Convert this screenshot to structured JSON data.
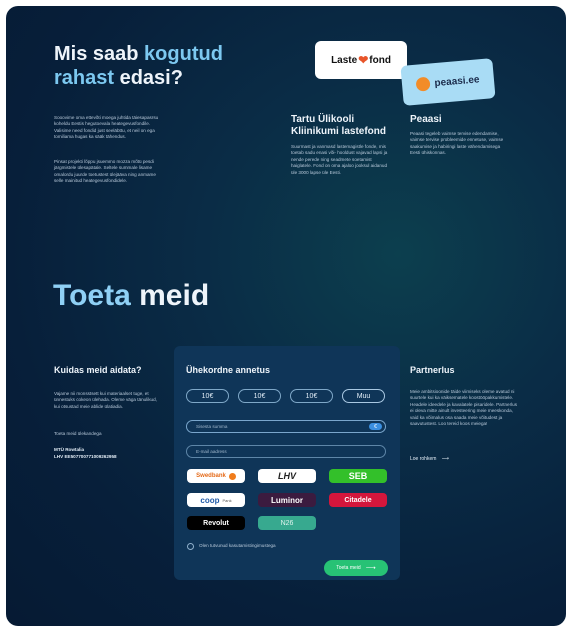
{
  "top": {
    "title_part1": "Mis saab ",
    "title_accent1": "kogutud",
    "title_accent2": "rahast",
    "title_part2": " edasi?",
    "intro_p1": "Sooovime oma ettevõti moega juhtida täiesapasrsu koheldu Eestis hegutoevala heategevusfondile. Valisime need fondid just seeläbttu, et neil on ega tomiliama hugas ka sääk tähendus.",
    "intro_p2": "Pinsat projekti lõppu jsuemmo mozza mõtü pesdi järgmistele ülesapätale. Seltele summale lisame omalordu juurde toetustest ülejääva ning anmame selle mainitud heategevusfondidele."
  },
  "fund1": {
    "logo_text": "Laste",
    "logo_text2": "fond",
    "title_line1": "Tartu Ülikooli",
    "title_line2": "Kliinikumi lastefond",
    "desc": "Suurmast ja vanmasd lastemagistle fonde, mis toetab sadu enasi või- hooldust vajavad lapsi ja nende perede ning seadmete soetamist haiglatele. Fond on oma ajaloo jooksul aidanud üle 3000 lapse üle Eesti."
  },
  "fund2": {
    "logo_text": "peaasi.ee",
    "title": "Peaasi",
    "desc": "Peaasi tegeleb vaimse tervise edendamise, vaimse tervise probleemide ennetuse, vaimse saakumise ja habiringi laste vähendamisega Eesti ühiskonnas."
  },
  "support": {
    "title_accent": "Toeta",
    "title_rest": " meid"
  },
  "help": {
    "title": "Kuidas meid aidata?",
    "p1": "Vajame nii monsstsett kui materiaalset tuge, et ünnestuks cokeon ülehada. Oleme väga tänulikud, kui otsustad meie ablide ülatiadia.",
    "p2": "Toeta meid ülekandega",
    "company": "MTÜ Rowtalia",
    "account": "LHV EE507700771009262958"
  },
  "donation": {
    "title": "Ühekordne annetus",
    "amounts": [
      "10€",
      "10€",
      "10€",
      "Muu"
    ],
    "amount_placeholder": "Sisesta summa",
    "currency": "€",
    "email_placeholder": "E-mail aadress",
    "banks": [
      "Swedbank",
      "LHV",
      "SEB",
      "coop",
      "Luminor",
      "Citadele",
      "Revolut",
      "N26"
    ],
    "coop_sub": "Pank",
    "terms": "Olen tutvunud kasutamistingimustega",
    "submit": "Toeta meid"
  },
  "partner": {
    "title": "Partnerlus",
    "desc": "Meie ambitsioonide täide viimiseks oleme avatud ni suurtele kui ka väiksematele koostööpakkumistele. Headele ideedele ja kavalatele pisaridele. Partnerlus ei oleva mitte ainult investeering meie meeskonda, vaid ka võimalus osa saada meie võitudest ja saavutustest. Loo tereid koos meiega!",
    "link": "Loe rohkem"
  },
  "colors": {
    "accent": "#7cc8f0",
    "green": "#27c275",
    "bg": "#071f3a"
  }
}
